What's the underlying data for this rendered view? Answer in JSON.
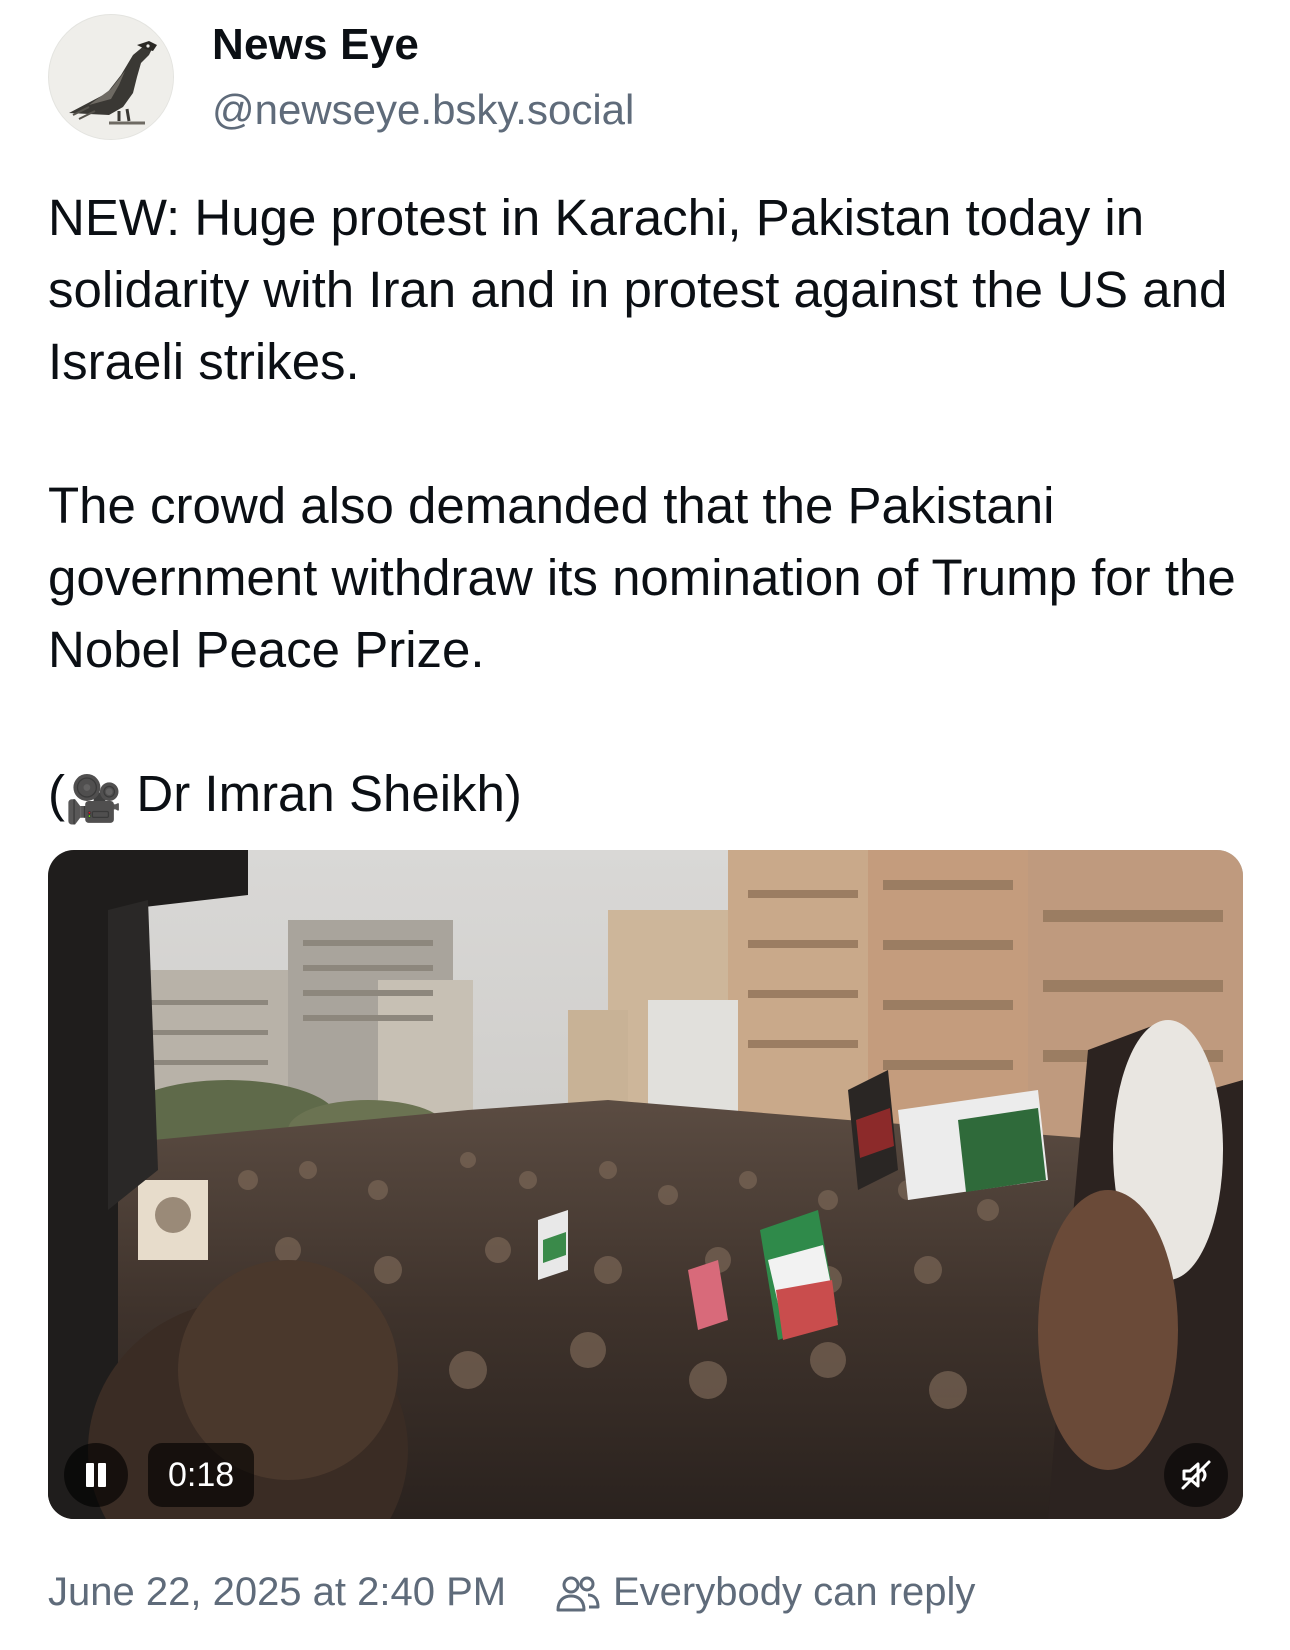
{
  "author": {
    "display_name": "News Eye",
    "handle": "@newseye.bsky.social",
    "avatar_icon": "eagle-avatar-icon"
  },
  "post": {
    "paragraph_1": "NEW: Huge protest in Karachi, Pakistan today in solidarity with Iran and in protest against the US and Israeli strikes.",
    "paragraph_2": "The crowd also demanded that the Pakistani government withdraw its nomination of Trump for the Nobel Peace Prize.",
    "credit_open": "(",
    "credit_emoji": "🎥",
    "credit_text": " Dr Imran Sheikh)"
  },
  "video": {
    "state": "playing",
    "time": "0:18",
    "pause_icon": "pause-icon",
    "mute_icon": "muted-speaker-icon"
  },
  "footer": {
    "timestamp": "June 22, 2025 at 2:40 PM",
    "reply_icon": "people-icon",
    "reply_setting": "Everybody can reply"
  },
  "colors": {
    "text": "#0b0f14",
    "secondary_text": "#5f6b7a",
    "overlay": "rgba(0,0,0,0.62)"
  }
}
